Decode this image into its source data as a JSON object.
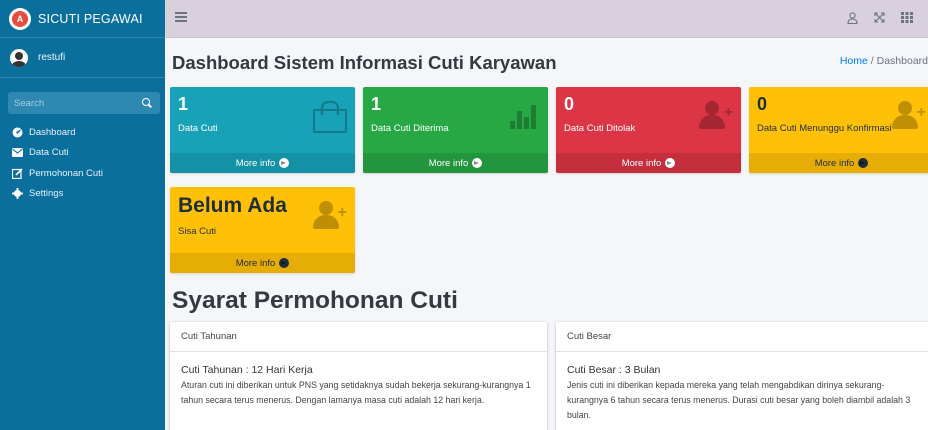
{
  "brand": {
    "name": "SICUTI PEGAWAI",
    "logo_letter": "A"
  },
  "user": {
    "name": "restufi"
  },
  "search": {
    "placeholder": "Search"
  },
  "sidebar": {
    "items": [
      {
        "label": "Dashboard",
        "icon": "dashboard-icon"
      },
      {
        "label": "Data Cuti",
        "icon": "envelope-icon"
      },
      {
        "label": "Permohonan Cuti",
        "icon": "edit-icon"
      },
      {
        "label": "Settings",
        "icon": "gear-icon"
      }
    ]
  },
  "topbar": {
    "menu_icon": "hamburger-icon",
    "icons": [
      "user-icon",
      "expand-icon",
      "grid-icon"
    ]
  },
  "header": {
    "title": "Dashboard Sistem Informasi Cuti Karyawan",
    "breadcrumb_home": "Home",
    "breadcrumb_sep": "/",
    "breadcrumb_current": "Dashboard"
  },
  "boxes": [
    {
      "value": "1",
      "label": "Data Cuti",
      "footer": "More info",
      "color": "#17a2b8",
      "icon": "bag-icon"
    },
    {
      "value": "1",
      "label": "Data Cuti Diterima",
      "footer": "More info",
      "color": "#28a745",
      "icon": "bar-chart-icon"
    },
    {
      "value": "0",
      "label": "Data Cuti Ditolak",
      "footer": "More info",
      "color": "#dc3545",
      "icon": "person-add-icon"
    },
    {
      "value": "0",
      "label": "Data Cuti Menunggu Konfirmasi",
      "footer": "More info",
      "color": "#ffc107",
      "icon": "person-add-icon"
    },
    {
      "value": "Belum Ada",
      "label": "Sisa Cuti",
      "footer": "More info",
      "color": "#ffc107",
      "icon": "person-add-icon"
    }
  ],
  "requirements": {
    "title": "Syarat Permohonan Cuti",
    "cards": [
      {
        "header": "Cuti Tahunan",
        "title": "Cuti Tahunan : 12 Hari Kerja",
        "text": "Aturan cuti ini diberikan untuk PNS yang setidaknya sudah bekerja sekurang-kurangnya 1 tahun secara terus menerus. Dengan lamanya masa cuti adalah 12 hari kerja."
      },
      {
        "header": "Cuti Besar",
        "title": "Cuti Besar : 3 Bulan",
        "text": "Jenis cuti ini diberikan kepada mereka yang telah mengabdikan dirinya sekurang-kurangnya 6 tahun secara terus menerus. Durasi cuti besar yang boleh diambil adalah 3 bulan."
      }
    ]
  }
}
